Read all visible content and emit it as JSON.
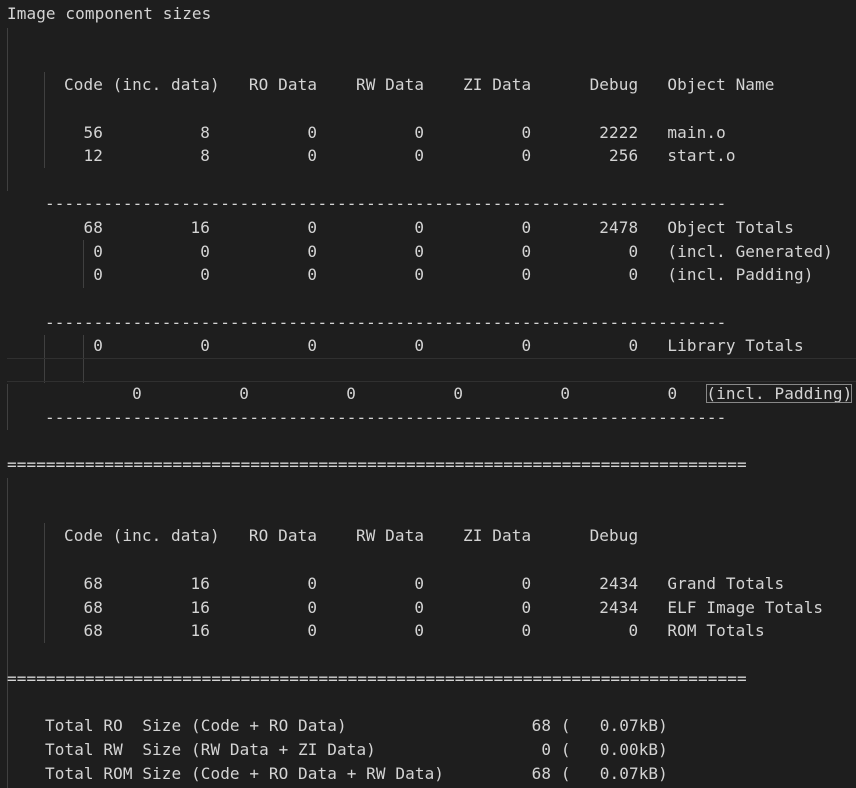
{
  "title": "Image component sizes",
  "section1": {
    "header": "Code (inc. data)   RO Data    RW Data    ZI Data      Debug   Object Name",
    "rows": [
      "  56          8          0          0          0       2222   main.o",
      "  12          8          0          0          0        256   start.o"
    ],
    "divider": "----------------------------------------------------------------------",
    "object_totals": [
      "  68         16          0          0          0       2478   Object Totals",
      "   0          0          0          0          0          0   (incl. Generated)",
      "   0          0          0          0          0          0   (incl. Padding)"
    ],
    "library_totals": [
      "   0          0          0          0          0          0   Library Totals",
      "   0          0          0          0          0          0   "
    ],
    "selected_token": "(incl. Padding)"
  },
  "equals_divider": "============================================================================",
  "section2": {
    "header": "Code (inc. data)   RO Data    RW Data    ZI Data      Debug",
    "rows": [
      "  68         16          0          0          0       2434   Grand Totals",
      "  68         16          0          0          0       2434   ELF Image Totals",
      "  68         16          0          0          0          0   ROM Totals"
    ]
  },
  "summary": [
    "Total RO  Size (Code + RO Data)                   68 (   0.07kB)",
    "Total RW  Size (RW Data + ZI Data)                 0 (   0.00kB)",
    "Total ROM Size (Code + RO Data + RW Data)         68 (   0.07kB)"
  ]
}
